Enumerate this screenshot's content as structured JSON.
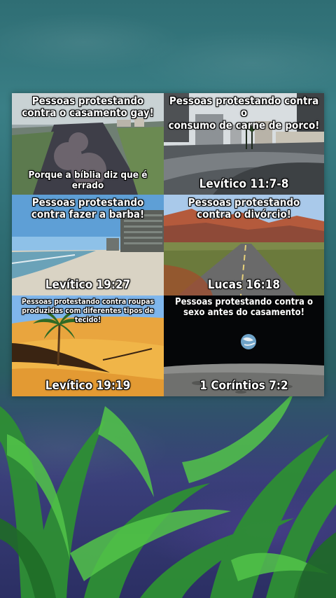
{
  "panels": [
    {
      "top": "Pessoas protestando\ncontra o casamento gay!",
      "bottom": "Porque a bíblia diz que é errado"
    },
    {
      "top": "Pessoas protestando contra o\nconsumo de carne de porco!",
      "bottom": "Levítico 11:7-8"
    },
    {
      "top": "Pessoas protestando\ncontra fazer a barba!",
      "bottom": "Levítico 19:27"
    },
    {
      "top": "Pessoas protestando\ncontra o divórcio!",
      "bottom": "Lucas 16:18"
    },
    {
      "top": "Pessoas protestando contra roupas\nproduzidas com diferentes tipos de tecido!",
      "bottom": "Levítico 19:19"
    },
    {
      "top": "Pessoas protestando contra o\nsexo antes do casamento!",
      "bottom": "1 Coríntios 7:2"
    }
  ],
  "colors": {
    "background_water": "#2f6e74",
    "seaweed": "#3fae3a",
    "deep_purple": "#2b2f63"
  }
}
